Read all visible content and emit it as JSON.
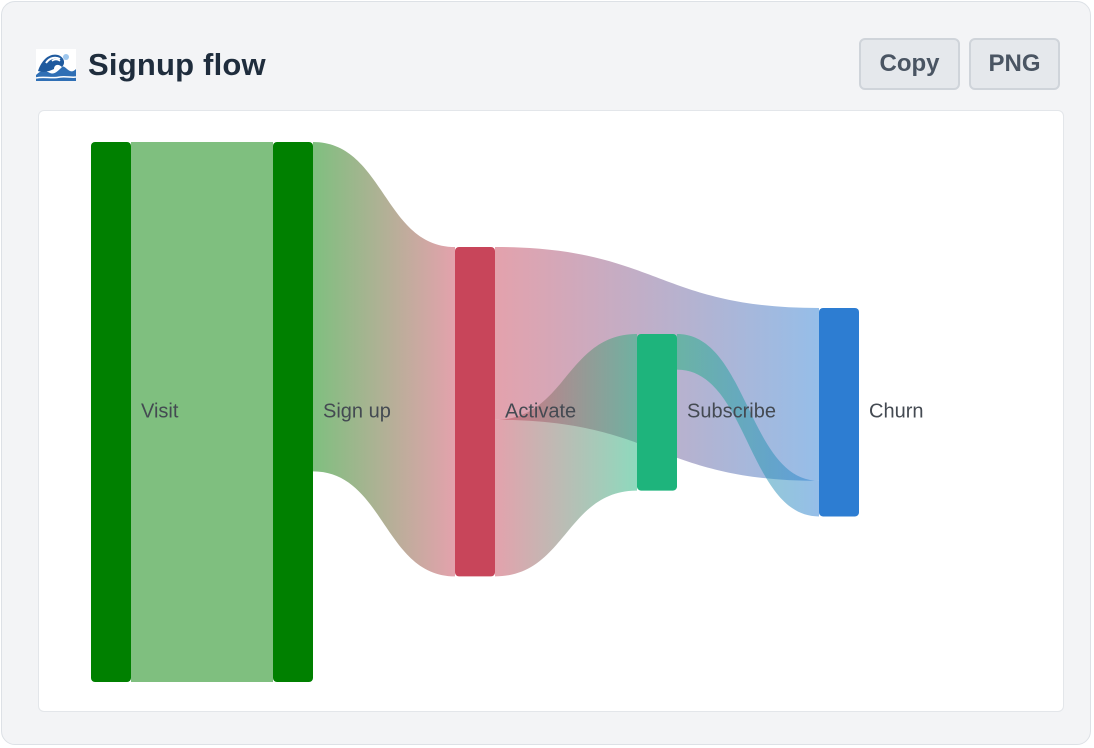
{
  "header": {
    "title": "Signup flow",
    "icon": "wave-icon"
  },
  "toolbar": {
    "copy_label": "Copy",
    "png_label": "PNG"
  },
  "chart_data": {
    "type": "sankey",
    "nodes": [
      {
        "name": "Visit",
        "color": "#008000"
      },
      {
        "name": "Sign up",
        "color": "#008000"
      },
      {
        "name": "Activate",
        "color": "#c8455a"
      },
      {
        "name": "Subscribe",
        "color": "#1eb47c"
      },
      {
        "name": "Churn",
        "color": "#2d7dd2"
      }
    ],
    "links": [
      {
        "source": "Visit",
        "target": "Sign up",
        "value": 100
      },
      {
        "source": "Sign up",
        "target": "Activate",
        "value": 61
      },
      {
        "source": "Activate",
        "target": "Churn",
        "value": 32
      },
      {
        "source": "Activate",
        "target": "Subscribe",
        "value": 29
      },
      {
        "source": "Subscribe",
        "target": "Churn",
        "value": 6.6
      }
    ]
  }
}
